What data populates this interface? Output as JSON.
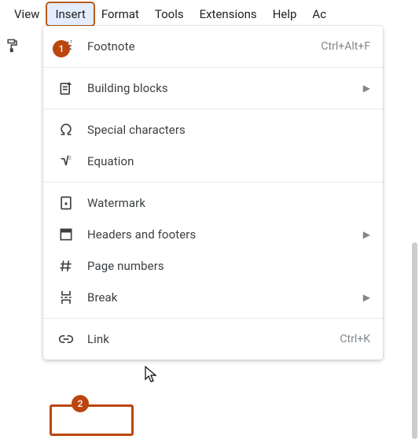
{
  "menubar": {
    "view": "View",
    "insert": "Insert",
    "format": "Format",
    "tools": "Tools",
    "extensions": "Extensions",
    "help": "Help",
    "acc": "Ac"
  },
  "menu": {
    "footnote": {
      "label": "Footnote",
      "shortcut": "Ctrl+Alt+F"
    },
    "building_blocks": {
      "label": "Building blocks"
    },
    "special_chars": {
      "label": "Special characters"
    },
    "equation": {
      "label": "Equation"
    },
    "watermark": {
      "label": "Watermark"
    },
    "headers_footers": {
      "label": "Headers and footers"
    },
    "page_numbers": {
      "label": "Page numbers"
    },
    "break": {
      "label": "Break"
    },
    "link": {
      "label": "Link",
      "shortcut": "Ctrl+K"
    }
  },
  "callouts": {
    "c1": "1",
    "c2": "2"
  }
}
